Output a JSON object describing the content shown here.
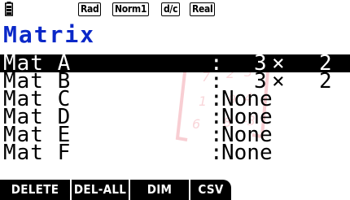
{
  "status_bar": {
    "battery_icon": "battery-icon",
    "angle_mode": "Rad",
    "display_mode": "Norm1",
    "fraction_mode": "d/c",
    "complex_mode": "Real"
  },
  "screen": {
    "title": "Matrix",
    "title_color": "#0a28c8",
    "accent_color": "#e8304a"
  },
  "matrices": [
    {
      "name": "Mat A",
      "colon": ":",
      "rows": "3",
      "cross": "×",
      "cols": "2",
      "selected": true
    },
    {
      "name": "Mat B",
      "colon": ":",
      "rows": "3",
      "cross": "×",
      "cols": "2",
      "selected": false
    },
    {
      "name": "Mat C",
      "colon": ":",
      "value": "None",
      "selected": false
    },
    {
      "name": "Mat D",
      "colon": ":",
      "value": "None",
      "selected": false
    },
    {
      "name": "Mat E",
      "colon": ":",
      "value": "None",
      "selected": false
    },
    {
      "name": "Mat F",
      "colon": ":",
      "value": "None",
      "selected": false
    }
  ],
  "function_keys": {
    "f1": "DELETE",
    "f2": "DEL-ALL",
    "f3": "DIM",
    "f4": "CSV"
  },
  "watermark_icon": "matrix-bracket-watermark-icon"
}
